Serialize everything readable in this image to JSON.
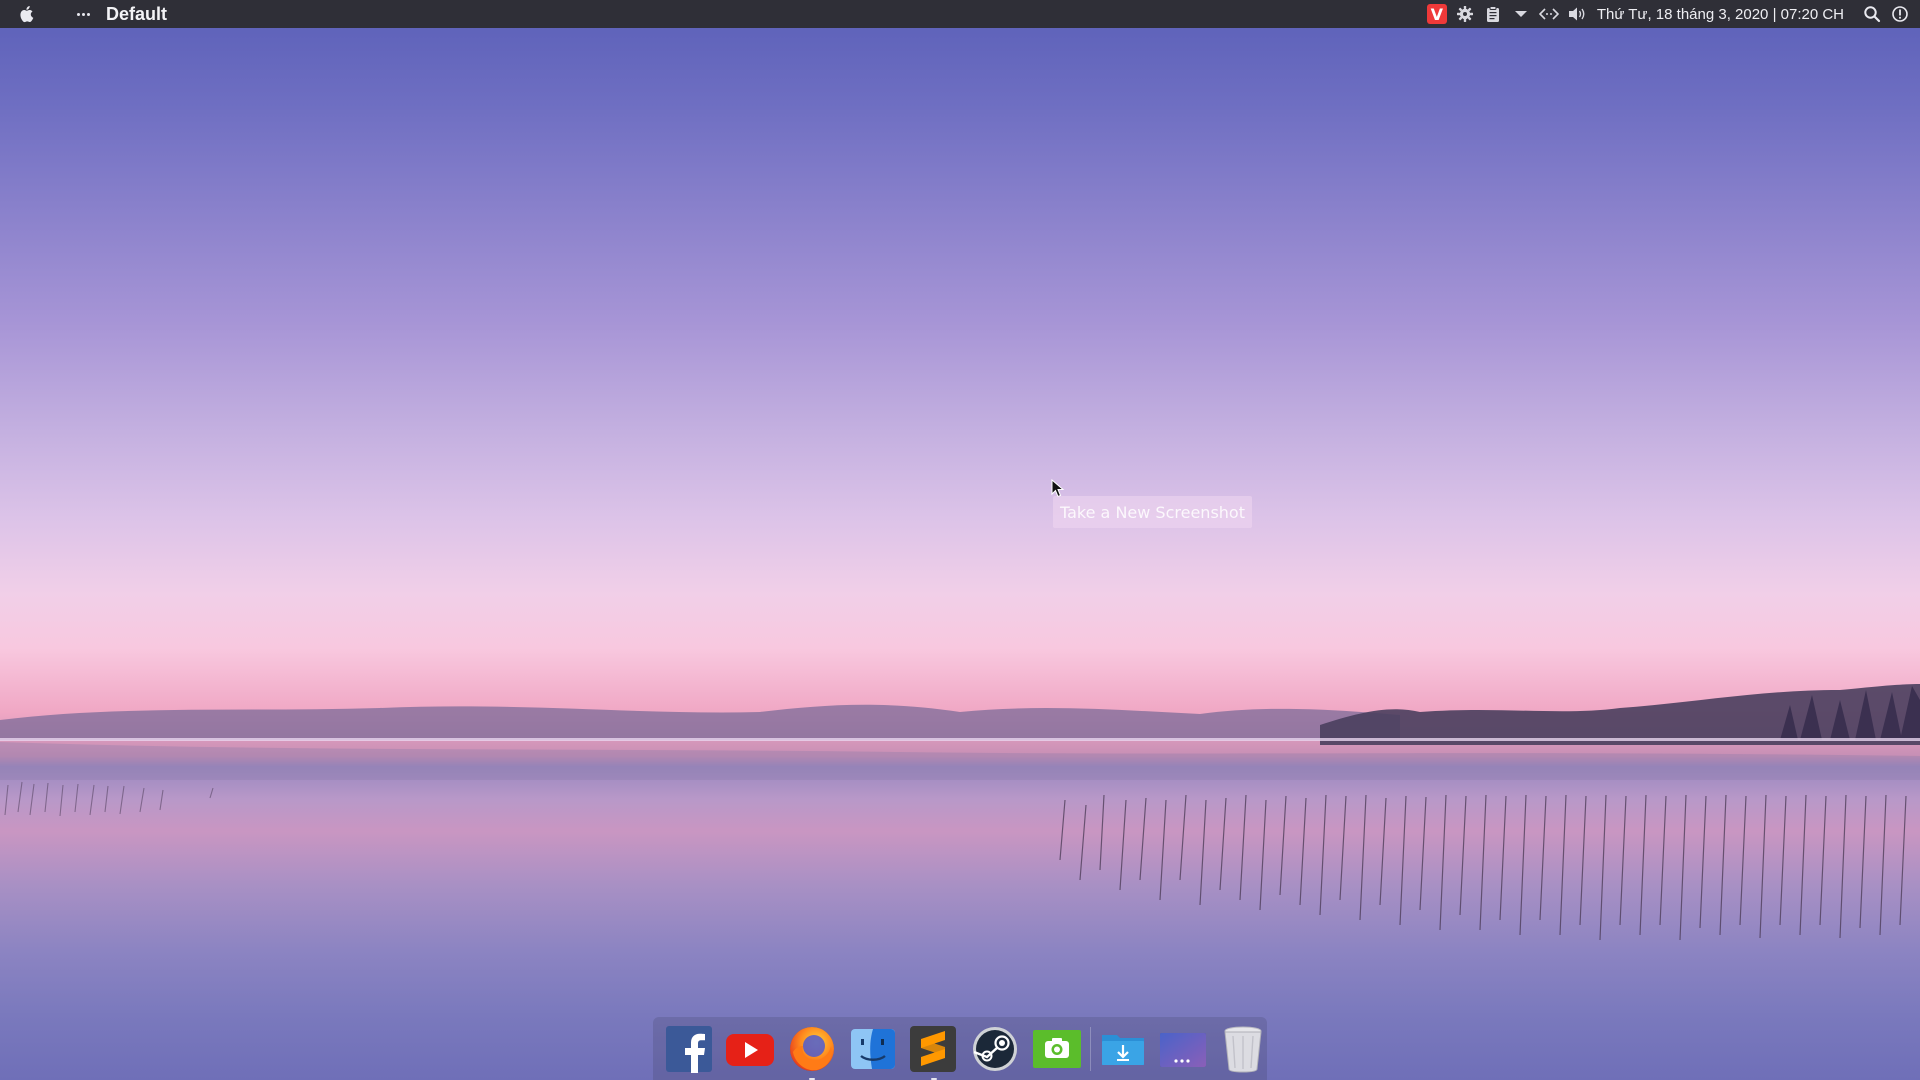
{
  "top_panel": {
    "window_title": "Default",
    "clock": "Thứ Tư, 18 tháng 3, 2020 | 07:20 CH",
    "tray_icons": [
      "vivaldi-icon",
      "settings-gear-icon",
      "clipboard-icon",
      "dropdown-arrow-icon",
      "network-icon",
      "volume-icon"
    ],
    "vivaldi_letter": "V"
  },
  "tooltip": {
    "text": "Take a New Screenshot"
  },
  "dock": {
    "items": [
      {
        "name": "facebook",
        "icon": "facebook-icon"
      },
      {
        "name": "youtube",
        "icon": "youtube-icon"
      },
      {
        "name": "firefox",
        "icon": "firefox-icon",
        "active": true
      },
      {
        "name": "finder",
        "icon": "finder-icon"
      },
      {
        "name": "sublime-text",
        "icon": "sublime-text-icon",
        "active": true
      },
      {
        "name": "steam",
        "icon": "steam-icon"
      },
      {
        "name": "screenshot",
        "icon": "screenshot-camera-icon"
      },
      {
        "name": "downloads",
        "icon": "downloads-folder-icon"
      },
      {
        "name": "terminal",
        "icon": "terminal-icon"
      },
      {
        "name": "trash",
        "icon": "trash-icon"
      }
    ]
  },
  "colors": {
    "panel_bg": "#2f2f37",
    "facebook": "#3b5998",
    "youtube": "#e62117",
    "sublime": "#ff9800",
    "screenshot_green": "#5bbd2b",
    "folder_blue": "#3aa4e6"
  }
}
